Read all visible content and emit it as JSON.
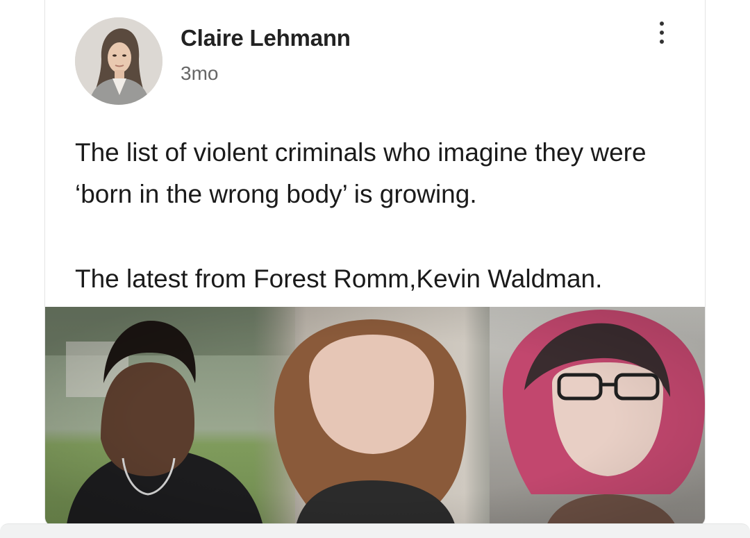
{
  "post": {
    "author_name": "Claire Lehmann",
    "timestamp": "3mo",
    "text_line_1": "The list of violent criminals who imagine they were ‘born in the wrong body’ is growing.",
    "text_line_2": "The latest from Forest Romm,Kevin Waldman."
  },
  "icons": {
    "more": "more-vertical-icon"
  },
  "colors": {
    "text": "#1a1a1a",
    "muted": "#666666",
    "card_border": "#e4e4e4"
  }
}
